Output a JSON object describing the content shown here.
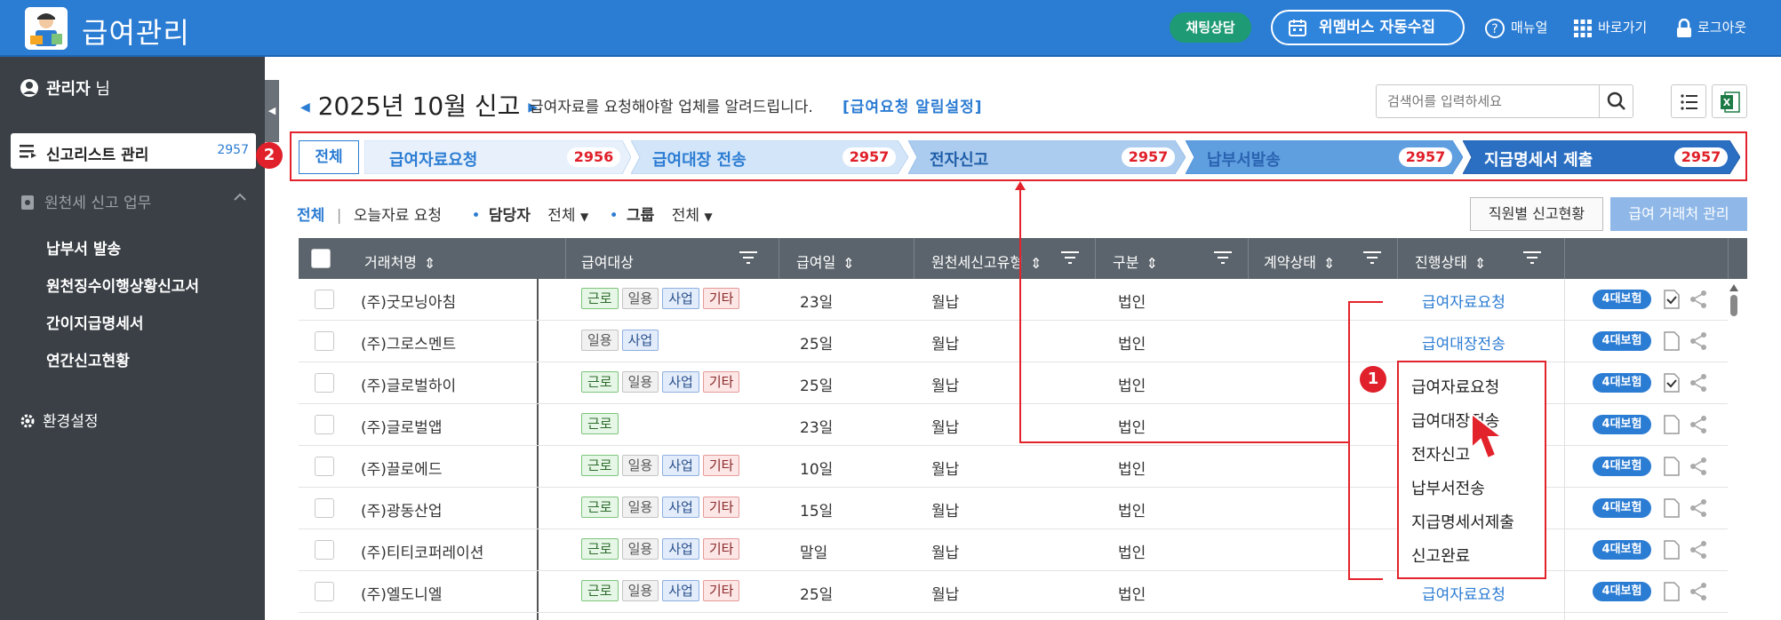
{
  "header": {
    "title": "급여관리",
    "chat_label": "채팅상담",
    "auto_label": "위멤버스 자동수집",
    "manual_label": "매뉴얼",
    "shortcut_label": "바로가기",
    "logout_label": "로그아웃"
  },
  "sidebar": {
    "admin_name": "관리자",
    "admin_suffix": "님",
    "active": {
      "label": "신고리스트 관리",
      "count": "2957"
    },
    "section_label": "원천세 신고 업무",
    "items": [
      {
        "label": "납부서 발송"
      },
      {
        "label": "원천징수이행상황신고서"
      },
      {
        "label": "간이지급명세서"
      },
      {
        "label": "연간신고현황"
      }
    ],
    "settings_label": "환경설정"
  },
  "callouts": {
    "first": "1",
    "second": "2"
  },
  "main": {
    "period": "2025년 10월 신고",
    "description": "급여자료를 요청해야할 업체를 알려드립니다.",
    "setting_link": "[급여요청 알림설정]",
    "search_placeholder": "검색어를 입력하세요"
  },
  "steps": {
    "all_label": "전체",
    "items": [
      {
        "label": "급여자료요청",
        "count": "2956"
      },
      {
        "label": "급여대장 전송",
        "count": "2957"
      },
      {
        "label": "전자신고",
        "count": "2957"
      },
      {
        "label": "납부서발송",
        "count": "2957"
      },
      {
        "label": "지급명세서 제출",
        "count": "2957"
      }
    ]
  },
  "filters": {
    "all": "전체",
    "separator": "|",
    "today": "오늘자료 요청",
    "manager_label": "담당자",
    "manager_value": "전체",
    "group_label": "그룹",
    "group_value": "전체",
    "employee_btn": "직원별 신고현황",
    "client_btn": "급여 거래처 관리"
  },
  "table": {
    "columns": [
      "거래처명",
      "급여대상",
      "급여일",
      "원천세신고유형",
      "구분",
      "계약상태",
      "진행상태"
    ],
    "insurance_label": "4대보험",
    "rows": [
      {
        "name": "(주)굿모닝아침",
        "tags": [
          "근로",
          "일용",
          "사업",
          "기타"
        ],
        "pay_day": "23일",
        "type": "월납",
        "kind": "법인",
        "status": "급여자료요청"
      },
      {
        "name": "(주)그로스멘트",
        "tags": [
          "일용",
          "사업"
        ],
        "pay_day": "25일",
        "type": "월납",
        "kind": "법인",
        "status": "급여대장전송"
      },
      {
        "name": "(주)글로벌하이",
        "tags": [
          "근로",
          "일용",
          "사업",
          "기타"
        ],
        "pay_day": "25일",
        "type": "월납",
        "kind": "법인",
        "status": ""
      },
      {
        "name": "(주)글로벌앱",
        "tags": [
          "근로"
        ],
        "pay_day": "23일",
        "type": "월납",
        "kind": "법인",
        "status": ""
      },
      {
        "name": "(주)끌로에드",
        "tags": [
          "근로",
          "일용",
          "사업",
          "기타"
        ],
        "pay_day": "10일",
        "type": "월납",
        "kind": "법인",
        "status": ""
      },
      {
        "name": "(주)광동산업",
        "tags": [
          "근로",
          "일용",
          "사업",
          "기타"
        ],
        "pay_day": "15일",
        "type": "월납",
        "kind": "법인",
        "status": ""
      },
      {
        "name": "(주)티티코퍼레이션",
        "tags": [
          "근로",
          "일용",
          "사업",
          "기타"
        ],
        "pay_day": "말일",
        "type": "월납",
        "kind": "법인",
        "status": ""
      },
      {
        "name": "(주)엘도니엘",
        "tags": [
          "근로",
          "일용",
          "사업",
          "기타"
        ],
        "pay_day": "25일",
        "type": "월납",
        "kind": "법인",
        "status": "급여자료요청"
      }
    ]
  },
  "status_dropdown": {
    "options": [
      "급여자료요청",
      "급여대장전송",
      "전자신고",
      "납부서전송",
      "지급명세서제출",
      "신고완료"
    ]
  },
  "colors": {
    "brand_blue": "#2b7cd3",
    "sidebar_bg": "#3b4046",
    "table_header": "#5b646c",
    "highlight_red": "#e3232b",
    "chat_green": "#1e9a74"
  }
}
